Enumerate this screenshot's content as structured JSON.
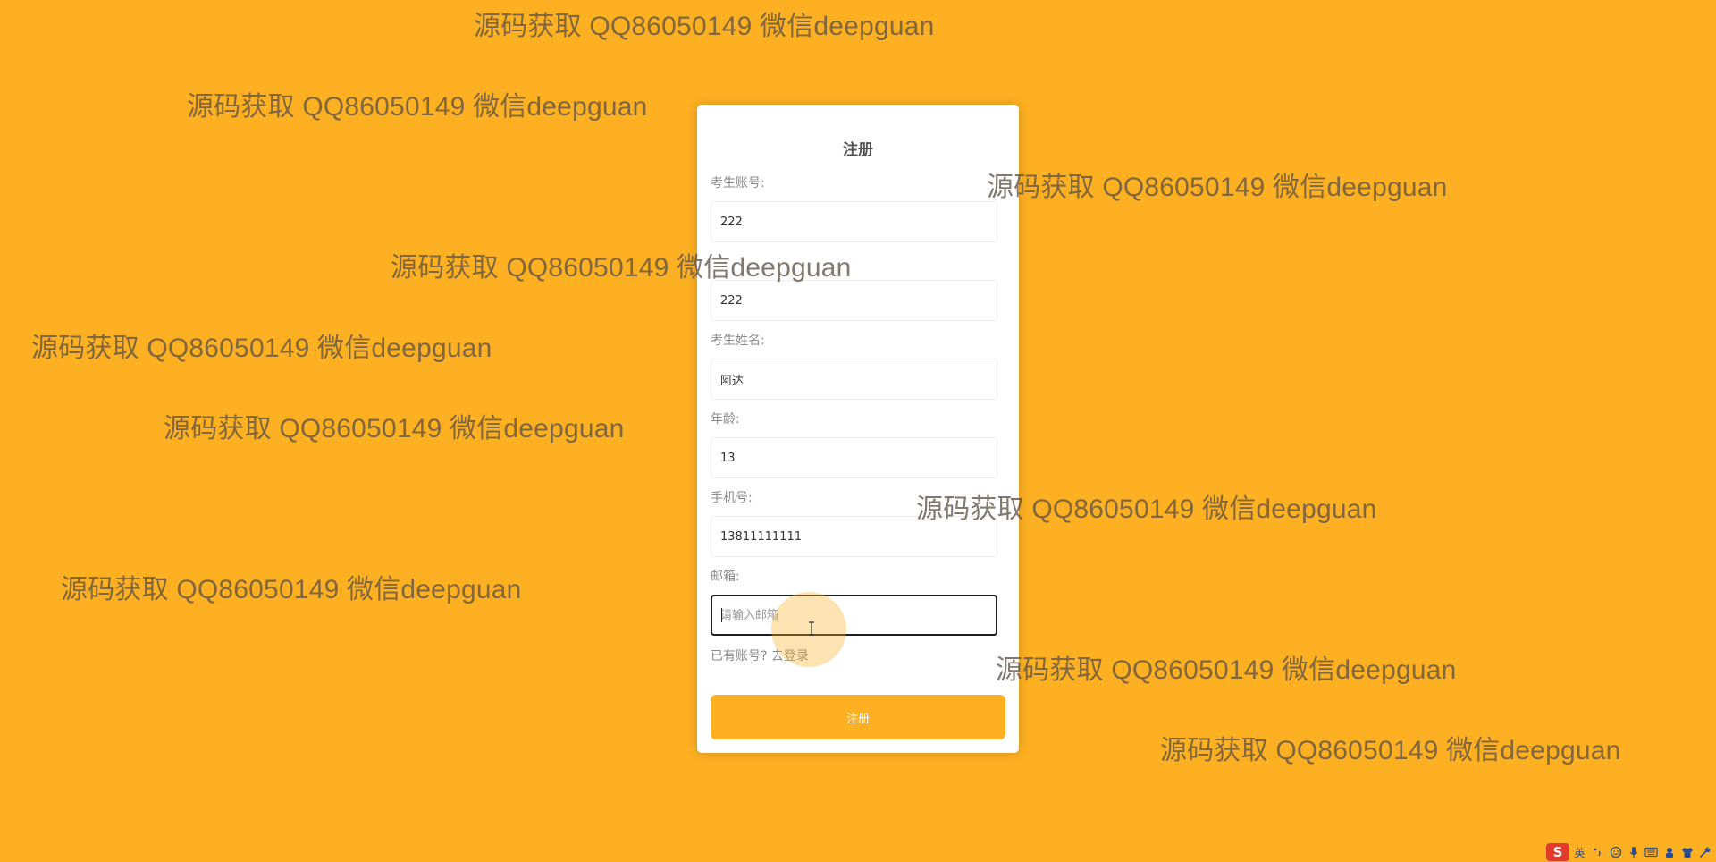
{
  "form": {
    "title": "注册",
    "fields": [
      {
        "label": "考生账号:",
        "value": "222",
        "placeholder": ""
      },
      {
        "label": "",
        "value": "222",
        "placeholder": ""
      },
      {
        "label": "考生姓名:",
        "value": "阿达",
        "placeholder": ""
      },
      {
        "label": "年龄:",
        "value": "13",
        "placeholder": ""
      },
      {
        "label": "手机号:",
        "value": "13811111111",
        "placeholder": ""
      },
      {
        "label": "邮箱:",
        "value": "",
        "placeholder": "请输入邮箱"
      }
    ],
    "login_prompt": "已有账号?",
    "login_link": "去登录",
    "submit_label": "注册"
  },
  "watermark_text": "源码获取 QQ86050149 微信deepguan",
  "watermarks": [
    {
      "text": "源码获取 QQ86050149 微信deepguan"
    },
    {
      "text": "源码获取 QQ86050149 微信deepguan"
    },
    {
      "text": "源码获取 QQ86050149 微信deepguan"
    },
    {
      "text": "源码获取 QQ86050149 微信deepguan"
    },
    {
      "text": "源码获取 QQ86050149 微信deepguan"
    },
    {
      "text": "源码获取 QQ86050149 微信deepguan"
    },
    {
      "text": "源码获取 QQ86050149 微信deepguan"
    },
    {
      "text": "源码获取 QQ86050149 微信deepguan"
    },
    {
      "text": "源码获取 QQ86050149 微信deepguan"
    },
    {
      "text": "源码获取 QQ86050149 微信deepguan"
    }
  ],
  "ime_toolbar": {
    "logo": "S",
    "mode": "英",
    "icons": [
      "punctuation-icon",
      "emoji-icon",
      "microphone-icon",
      "keyboard-icon",
      "toolbox-icon",
      "skin-icon",
      "settings-icon"
    ]
  },
  "colors": {
    "background": "#fdb022",
    "card": "#ffffff",
    "button": "#fdb022",
    "watermark": "#5f5244"
  }
}
